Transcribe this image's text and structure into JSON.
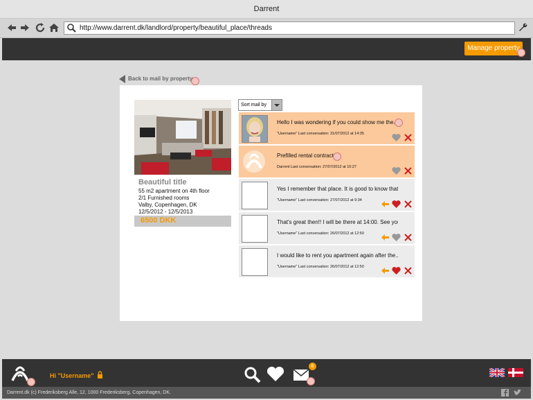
{
  "browser": {
    "window_title": "Darrent",
    "url": "http://www.darrent.dk/landlord/property/beautiful_place/threads"
  },
  "header": {
    "manage_label": "Manage property"
  },
  "page": {
    "back_label": "Back to mail by property",
    "sort_label": "Sort mail by"
  },
  "property": {
    "title": "Beautiful title",
    "details": [
      "55 m2 apartment on 4th floor",
      "2/1 Furnished rooms",
      "Valby, Copenhagen, DK",
      "12/5/2012 - 12/5/2013"
    ],
    "price": "6500 DKK"
  },
  "messages": [
    {
      "text": "Hello I was wondering if you could show me the...",
      "meta": "\"Username\" Last conversation: 31/07/2012 at 14:35"
    },
    {
      "text": "Prefilled rental contract",
      "meta": "Darrent  Last conversation: 27/07/2012 at 10:27"
    },
    {
      "text": "Yes I remember that place. It is good to know that...",
      "meta": "\"Username\" Last conversation: 27/07/2012 at 9:34"
    },
    {
      "text": "That's great then!! I will be there at 14:00. See you...",
      "meta": "\"Username\" Last conversation: 26/07/2012 at 12:50"
    },
    {
      "text": "I would like to rent you apartment again after the...",
      "meta": "\"Username\" Last conversation: 26/07/2012 at 12:50"
    }
  ],
  "footer": {
    "greeting": "Hi \"Username\"",
    "mail_count": "6",
    "copyright": "Darrent.dk (c) Frederiksberg Alle, 12, 1000 Frederiksberg, Copenhagen, DK."
  },
  "colors": {
    "accent": "#f59a00",
    "highlight_row": "#fcc99c",
    "dark_bar": "#333333",
    "heart_red": "#cc1f1f"
  }
}
